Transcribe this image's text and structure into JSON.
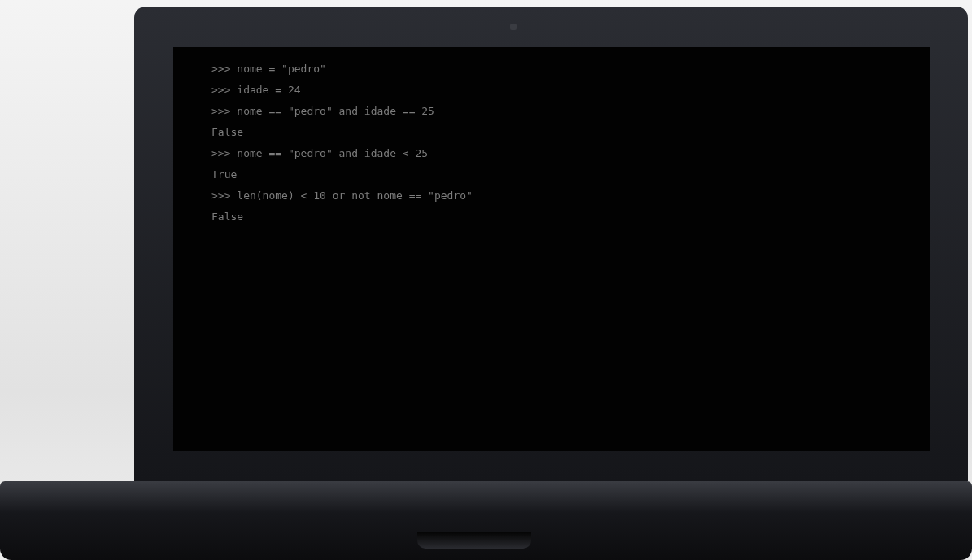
{
  "terminal": {
    "lines": [
      ">>> nome = \"pedro\"",
      ">>> idade = 24",
      ">>> nome == \"pedro\" and idade == 25",
      "False",
      ">>> nome == \"pedro\" and idade < 25",
      "True",
      ">>> len(nome) < 10 or not nome == \"pedro\"",
      "False"
    ]
  }
}
